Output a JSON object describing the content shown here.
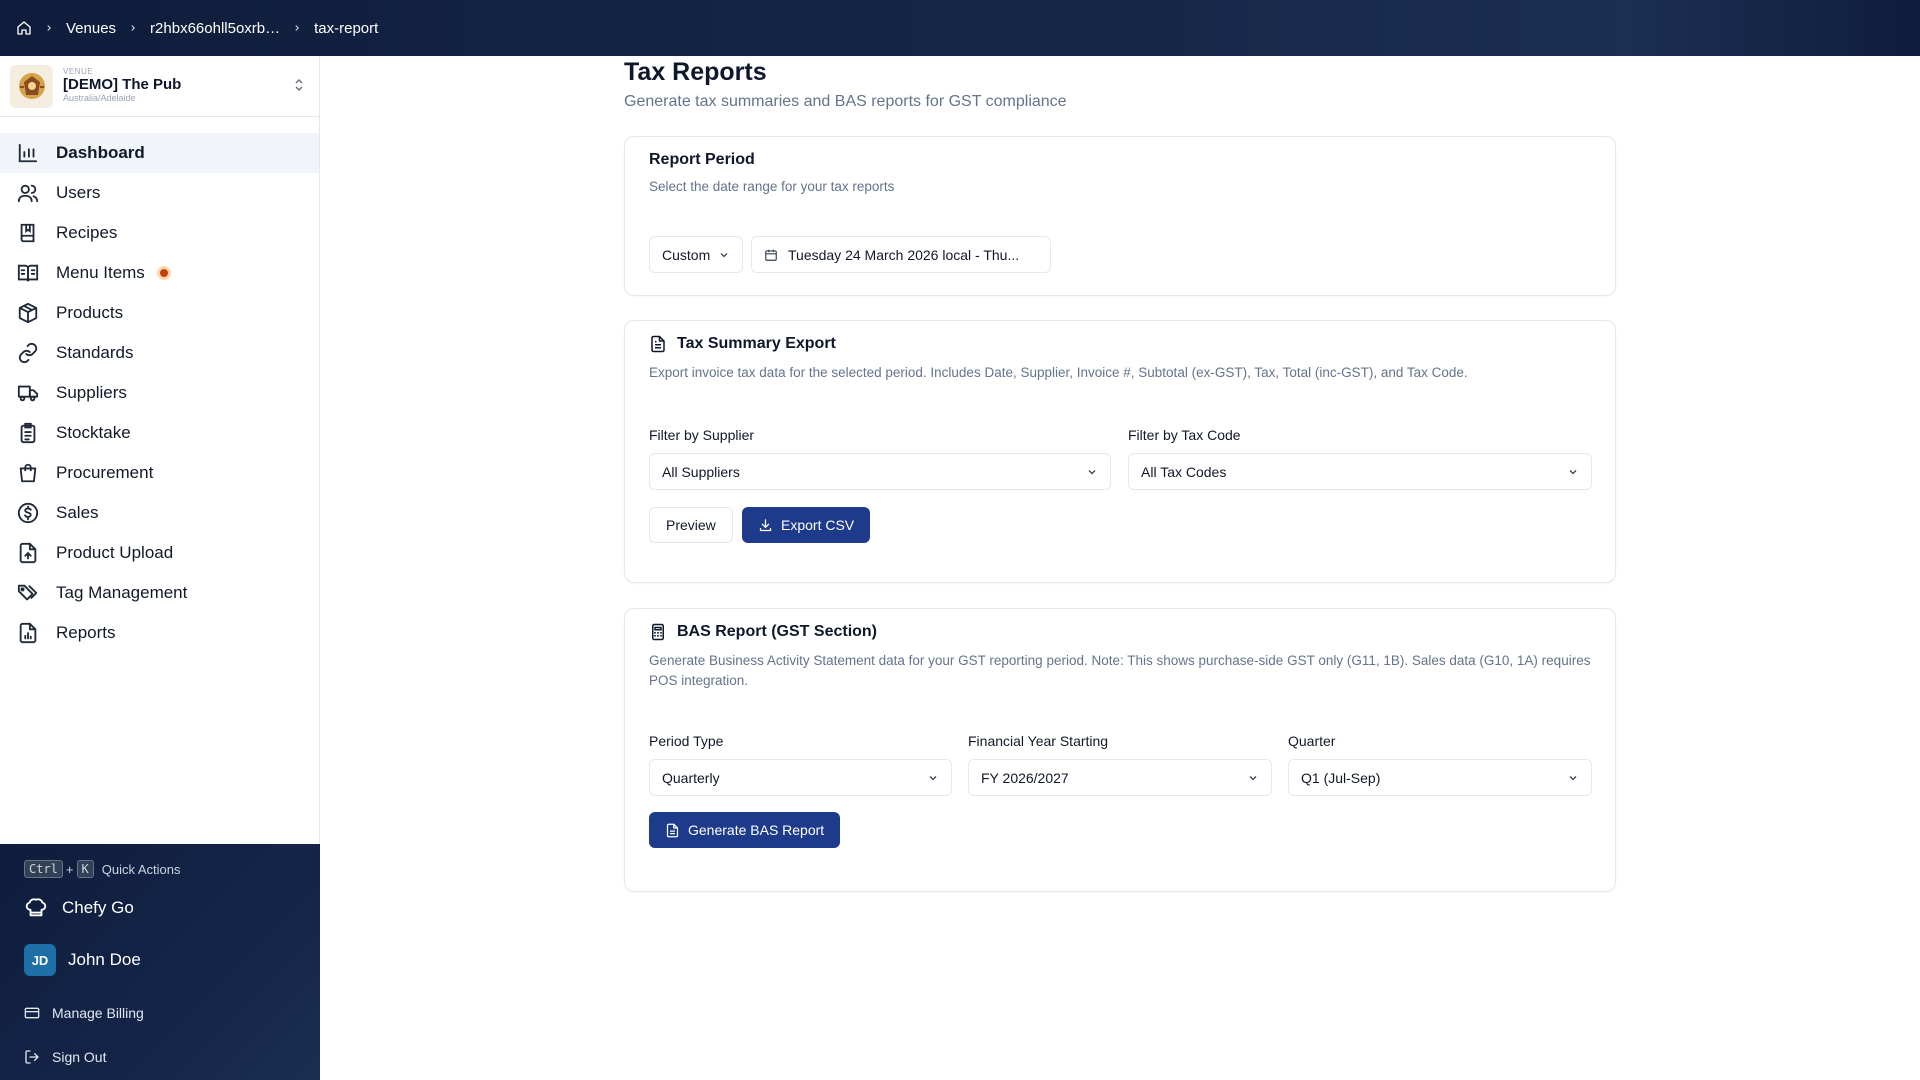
{
  "breadcrumb": {
    "home_icon": "home-icon",
    "items": [
      "Venues",
      "r2hbx66ohll5oxrb…",
      "tax-report"
    ]
  },
  "venue": {
    "tag": "VENUE",
    "name": "[DEMO] The Pub",
    "timezone": "Australia/Adelaide"
  },
  "sidebar": {
    "items": [
      {
        "label": "Dashboard",
        "icon": "bar-chart-icon",
        "active": true
      },
      {
        "label": "Users",
        "icon": "users-icon"
      },
      {
        "label": "Recipes",
        "icon": "book-icon"
      },
      {
        "label": "Menu Items",
        "icon": "book-open-icon",
        "badge": true
      },
      {
        "label": "Products",
        "icon": "boxes-icon"
      },
      {
        "label": "Standards",
        "icon": "link-icon"
      },
      {
        "label": "Suppliers",
        "icon": "truck-icon"
      },
      {
        "label": "Stocktake",
        "icon": "clipboard-icon"
      },
      {
        "label": "Procurement",
        "icon": "shopping-bag-icon"
      },
      {
        "label": "Sales",
        "icon": "dollar-circle-icon"
      },
      {
        "label": "Product Upload",
        "icon": "file-upload-icon"
      },
      {
        "label": "Tag Management",
        "icon": "tags-icon"
      },
      {
        "label": "Reports",
        "icon": "file-chart-icon"
      }
    ],
    "badge_color": "#c2410c"
  },
  "footer": {
    "kbd_ctrl": "Ctrl",
    "kbd_plus": "+",
    "kbd_k": "K",
    "quick_actions": "Quick Actions",
    "chefy_go": "Chefy Go",
    "user_initials": "JD",
    "user_name": "John Doe",
    "manage_billing": "Manage Billing",
    "sign_out": "Sign Out"
  },
  "page": {
    "title": "Tax Reports",
    "subtitle": "Generate tax summaries and BAS reports for GST compliance"
  },
  "report_period": {
    "title": "Report Period",
    "description": "Select the date range for your tax reports",
    "range_type": "Custom",
    "date_range": "Tuesday 24 March 2026 local - Thu..."
  },
  "tax_summary": {
    "title": "Tax Summary Export",
    "description": "Export invoice tax data for the selected period. Includes Date, Supplier, Invoice #, Subtotal (ex-GST), Tax, Total (inc-GST), and Tax Code.",
    "supplier_label": "Filter by Supplier",
    "supplier_value": "All Suppliers",
    "taxcode_label": "Filter by Tax Code",
    "taxcode_value": "All Tax Codes",
    "preview_label": "Preview",
    "export_label": "Export CSV"
  },
  "bas_report": {
    "title": "BAS Report (GST Section)",
    "description": "Generate Business Activity Statement data for your GST reporting period. Note: This shows purchase-side GST only (G11, 1B). Sales data (G10, 1A) requires POS integration.",
    "period_type_label": "Period Type",
    "period_type_value": "Quarterly",
    "fy_label": "Financial Year Starting",
    "fy_value": "FY 2026/2027",
    "quarter_label": "Quarter",
    "quarter_value": "Q1 (Jul-Sep)",
    "generate_label": "Generate BAS Report"
  },
  "colors": {
    "primary": "#1e3a8a",
    "topbar": "#0f1d3c"
  }
}
